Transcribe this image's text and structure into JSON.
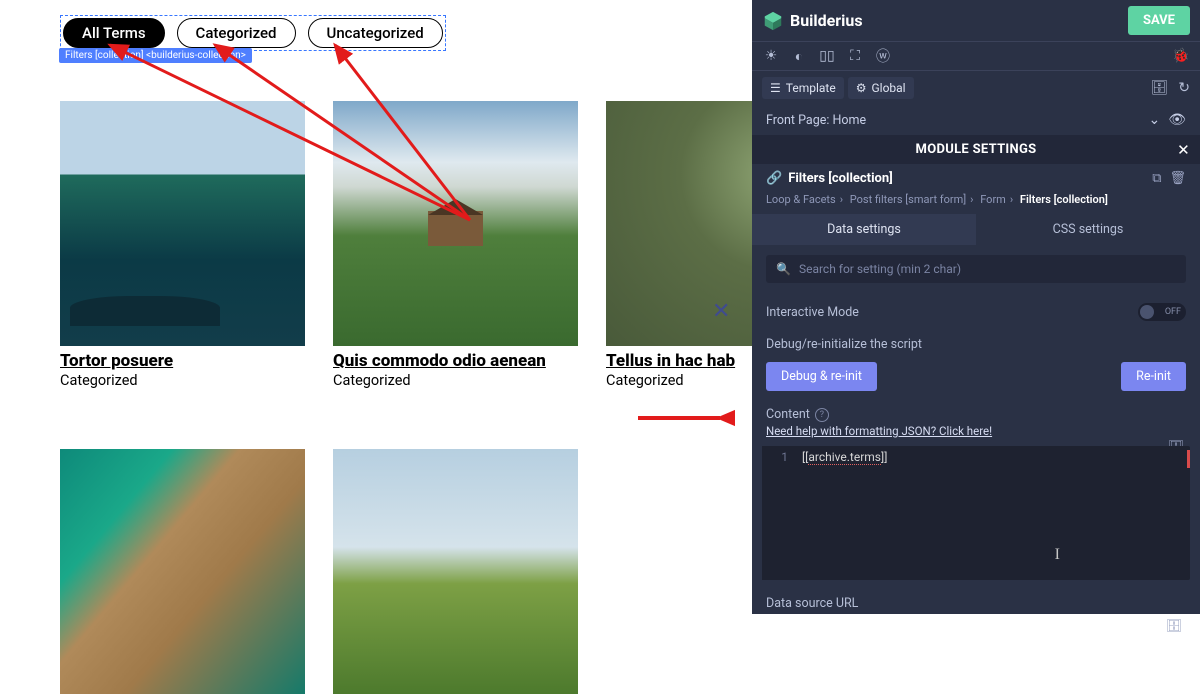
{
  "filters": {
    "badge": "Filters [collection] <builderius-collection>",
    "items": [
      {
        "label": "All Terms",
        "active": true
      },
      {
        "label": "Categorized",
        "active": false
      },
      {
        "label": "Uncategorized",
        "active": false
      }
    ]
  },
  "posts": [
    {
      "title": "Tortor posuere",
      "cat": "Categorized",
      "thumb": "t1"
    },
    {
      "title": "Quis commodo odio aenean",
      "cat": "Categorized",
      "thumb": "t2"
    },
    {
      "title": "Tellus in hac hab",
      "cat": "Categorized",
      "thumb": "t3"
    },
    {
      "title": "",
      "cat": "",
      "thumb": "t4"
    },
    {
      "title": "",
      "cat": "",
      "thumb": "t5"
    }
  ],
  "app": {
    "name": "Builderius",
    "save": "SAVE"
  },
  "tabs": {
    "template": "Template",
    "global": "Global"
  },
  "context": "Front Page: Home",
  "module_settings_title": "MODULE SETTINGS",
  "module": {
    "name": "Filters [collection]",
    "crumb": [
      "Loop & Facets",
      "Post filters [smart form]",
      "Form",
      "Filters [collection]"
    ]
  },
  "subtabs": {
    "data": "Data settings",
    "css": "CSS settings"
  },
  "search_placeholder": "Search for setting (min 2 char)",
  "interactive_label": "Interactive Mode",
  "toggle_off": "OFF",
  "debug_label": "Debug/re-initialize the script",
  "buttons": {
    "debug": "Debug & re-init",
    "reinit": "Re-init"
  },
  "content_label": "Content",
  "help_link": "Need help with formatting JSON? Click here!",
  "code": {
    "line_no": "1",
    "text": "[[archive.terms]]"
  },
  "ds_label": "Data source URL"
}
